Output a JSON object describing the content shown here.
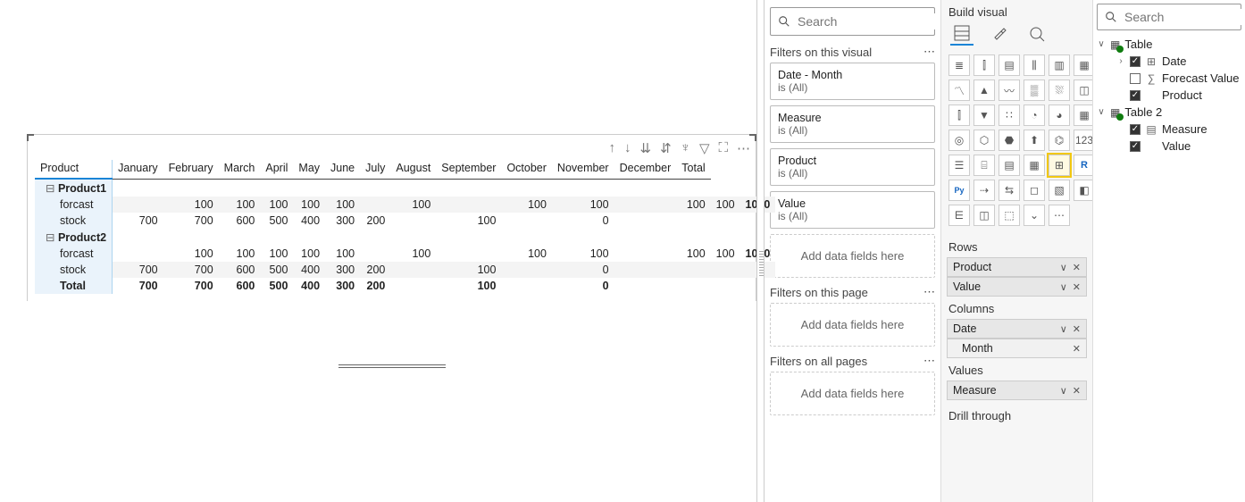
{
  "canvas": {
    "toolbar_icons": [
      "arrow-up",
      "arrow-down",
      "sort-asc",
      "sort-desc",
      "hierarchy",
      "filter",
      "focus",
      "more"
    ],
    "columns": [
      "Product",
      "January",
      "February",
      "March",
      "April",
      "May",
      "June",
      "July",
      "August",
      "September",
      "October",
      "November",
      "December",
      "Total"
    ],
    "groups": [
      {
        "name": "Product1",
        "rows": [
          {
            "label": "forcast",
            "cells": [
              "",
              "",
              "100",
              "100",
              "100",
              "100",
              "100",
              "",
              "100",
              "",
              "100",
              "100",
              "",
              "100",
              "100"
            ],
            "total": "1000",
            "alt": true
          },
          {
            "label": "stock",
            "cells": [
              "",
              "700",
              "700",
              "600",
              "500",
              "400",
              "300",
              "200",
              "",
              "100",
              "",
              "0",
              "",
              "",
              ""
            ],
            "total": ""
          }
        ]
      },
      {
        "name": "Product2",
        "rows": [
          {
            "label": "forcast",
            "cells": [
              "",
              "",
              "100",
              "100",
              "100",
              "100",
              "100",
              "",
              "100",
              "",
              "100",
              "100",
              "",
              "100",
              "100"
            ],
            "total": "1000"
          },
          {
            "label": "stock",
            "cells": [
              "",
              "700",
              "700",
              "600",
              "500",
              "400",
              "300",
              "200",
              "",
              "100",
              "",
              "0",
              "",
              "",
              ""
            ],
            "total": "",
            "alt": true
          }
        ]
      }
    ],
    "grand": {
      "label": "Total",
      "cells": [
        "",
        "700",
        "700",
        "600",
        "500",
        "400",
        "300",
        "200",
        "",
        "100",
        "",
        "0",
        "",
        "",
        ""
      ],
      "total": ""
    }
  },
  "filters": {
    "search_placeholder": "Search",
    "sections": {
      "visual_title": "Filters on this visual",
      "page_title": "Filters on this page",
      "all_title": "Filters on all pages",
      "add_placeholder": "Add data fields here"
    },
    "cards": [
      {
        "name": "Date - Month",
        "cond": "is (All)"
      },
      {
        "name": "Measure",
        "cond": "is (All)"
      },
      {
        "name": "Product",
        "cond": "is (All)"
      },
      {
        "name": "Value",
        "cond": "is (All)"
      }
    ]
  },
  "build": {
    "title": "Build visual",
    "wells": {
      "rows_title": "Rows",
      "cols_title": "Columns",
      "vals_title": "Values",
      "rows": [
        {
          "label": "Product"
        },
        {
          "label": "Value"
        }
      ],
      "cols": [
        {
          "label": "Date"
        },
        {
          "label": "Month",
          "sub": true
        }
      ],
      "vals": [
        {
          "label": "Measure"
        }
      ]
    },
    "drill_title": "Drill through"
  },
  "fields": {
    "search_placeholder": "Search",
    "tables": [
      {
        "name": "Table",
        "expanded": true,
        "items": [
          {
            "name": "Date",
            "checked": true,
            "icon": "hierarchy",
            "expandable": true
          },
          {
            "name": "Forecast Value",
            "checked": false,
            "icon": "sigma"
          },
          {
            "name": "Product",
            "checked": true,
            "icon": ""
          }
        ]
      },
      {
        "name": "Table 2",
        "expanded": true,
        "items": [
          {
            "name": "Measure",
            "checked": true,
            "icon": "calc"
          },
          {
            "name": "Value",
            "checked": true,
            "icon": ""
          }
        ]
      }
    ]
  }
}
